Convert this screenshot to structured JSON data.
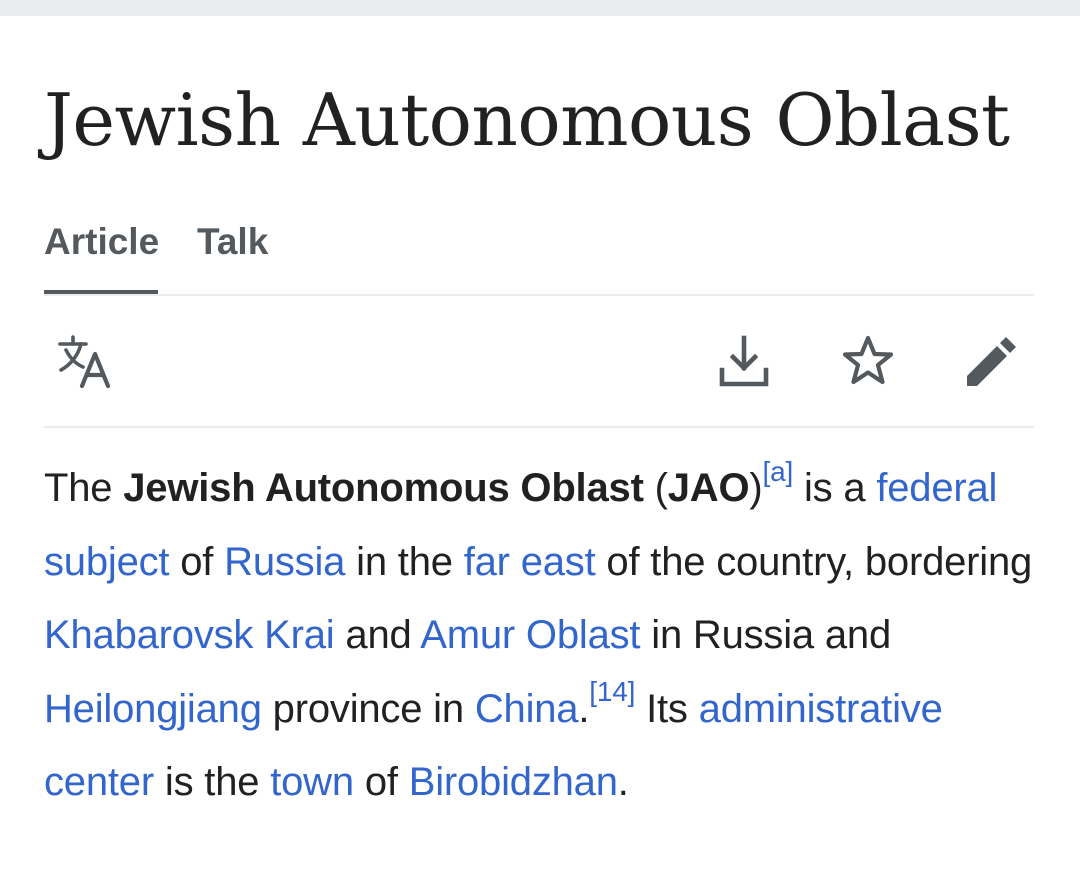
{
  "page": {
    "title": "Jewish Autonomous Oblast"
  },
  "tabs": {
    "article": "Article",
    "talk": "Talk"
  },
  "toolbar": {
    "icons": [
      "language-icon",
      "download-icon",
      "star-icon",
      "pencil-icon"
    ]
  },
  "colors": {
    "link": "#3366cc",
    "text": "#202122",
    "tab_text": "#54595d",
    "divider": "#eaecf0"
  },
  "article": {
    "p1": "The ",
    "bold_name": "Jewish Autonomous Oblast",
    "p2": " (",
    "bold_abbr": "JAO",
    "p3": ")",
    "ref_a": "[a]",
    "p4": " is a ",
    "link_federal_subject": "federal subject",
    "p5": " of ",
    "link_russia": "Russia",
    "p6": " in the ",
    "link_far_east": "far east",
    "p7": " of the country, bordering ",
    "link_khabarovsk": "Khabarovsk Krai",
    "p8": " and ",
    "link_amur": "Amur Oblast",
    "p9": " in Russia and ",
    "link_heilongjiang": "Heilongjiang",
    "p10": " province in ",
    "link_china": "China",
    "p11": ".",
    "ref_14": "[14]",
    "p12": " Its ",
    "link_admin_center": "administrative center",
    "p13": " is the ",
    "link_town": "town",
    "p14": " of ",
    "link_birobidzhan": "Birobidzhan",
    "p15": "."
  }
}
